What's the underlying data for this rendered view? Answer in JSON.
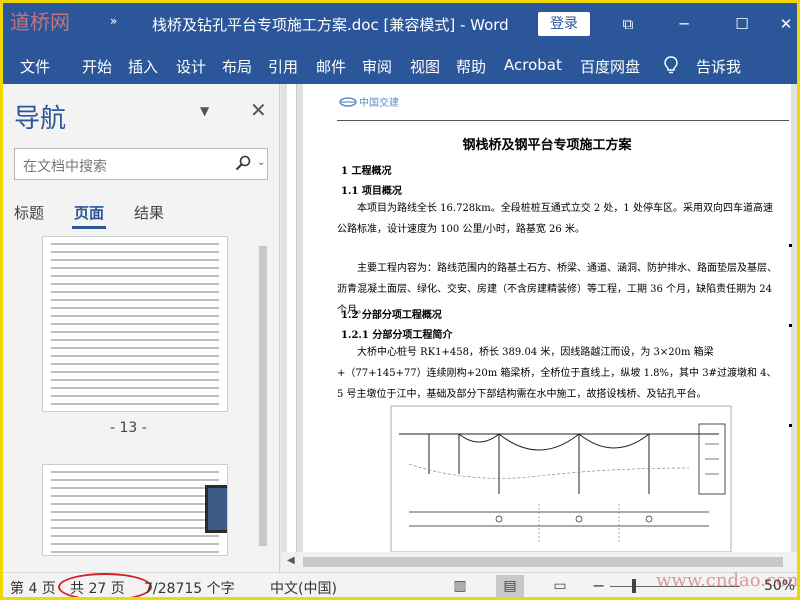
{
  "titlebar": {
    "logo": "道桥网",
    "qa_more": "»",
    "title": "栈桥及钻孔平台专项施工方案.doc [兼容模式]  -  Word",
    "login": "登录",
    "restore": "⧉",
    "minimize": "─",
    "maximize": "☐",
    "close": "✕"
  },
  "ribbon": {
    "tabs": [
      "文件",
      "开始",
      "插入",
      "设计",
      "布局",
      "引用",
      "邮件",
      "审阅",
      "视图",
      "帮助",
      "Acrobat",
      "百度网盘"
    ],
    "tell_me": "告诉我"
  },
  "nav": {
    "title": "导航",
    "search_placeholder": "在文档中搜索",
    "tabs": [
      "标题",
      "页面",
      "结果"
    ],
    "active_tab": "页面",
    "page_label": "- 13 -"
  },
  "doc": {
    "logo_text": "中国交建",
    "title": "钢栈桥及钢平台专项施工方案",
    "h1": "1 工程概况",
    "h1_1": "1.1  项目概况",
    "p1": "本项目为路线全长 16.728km。全段桩桩互通式立交 2 处，1 处停车区。采用双向四车道高速公路标准，设计速度为 100 公里/小时，路基宽 26 米。",
    "p2": "主要工程内容为：路线范围内的路基土石方、桥梁、通道、涵洞、防护排水、路面垫层及基层、沥青混凝土面层、绿化、交安、房建（不含房建精装修）等工程，工期 36 个月，缺陷责任期为 24 个月。",
    "h1_2": "1.2  分部分项工程概况",
    "h1_2_1": "1.2.1  分部分项工程简介",
    "p3": "大桥中心桩号 RK1+458，桥长 389.04 米，因线路越江而设，为 3×20m 箱梁+（77+145+77）连续刚构+20m 箱梁桥，全桥位于直线上，纵坡 1.8%，其中 3#过渡墩和 4、5 号主墩位于江中，基础及部分下部结构需在水中施工，故搭设栈桥、及钻孔平台。"
  },
  "status": {
    "page": "第 4 页",
    "total": "共 27 页",
    "words": "7/28715 个字",
    "lang": "中文(中国)",
    "zoom": "50%",
    "watermark": "www.cndao.com"
  },
  "chart_data": null
}
